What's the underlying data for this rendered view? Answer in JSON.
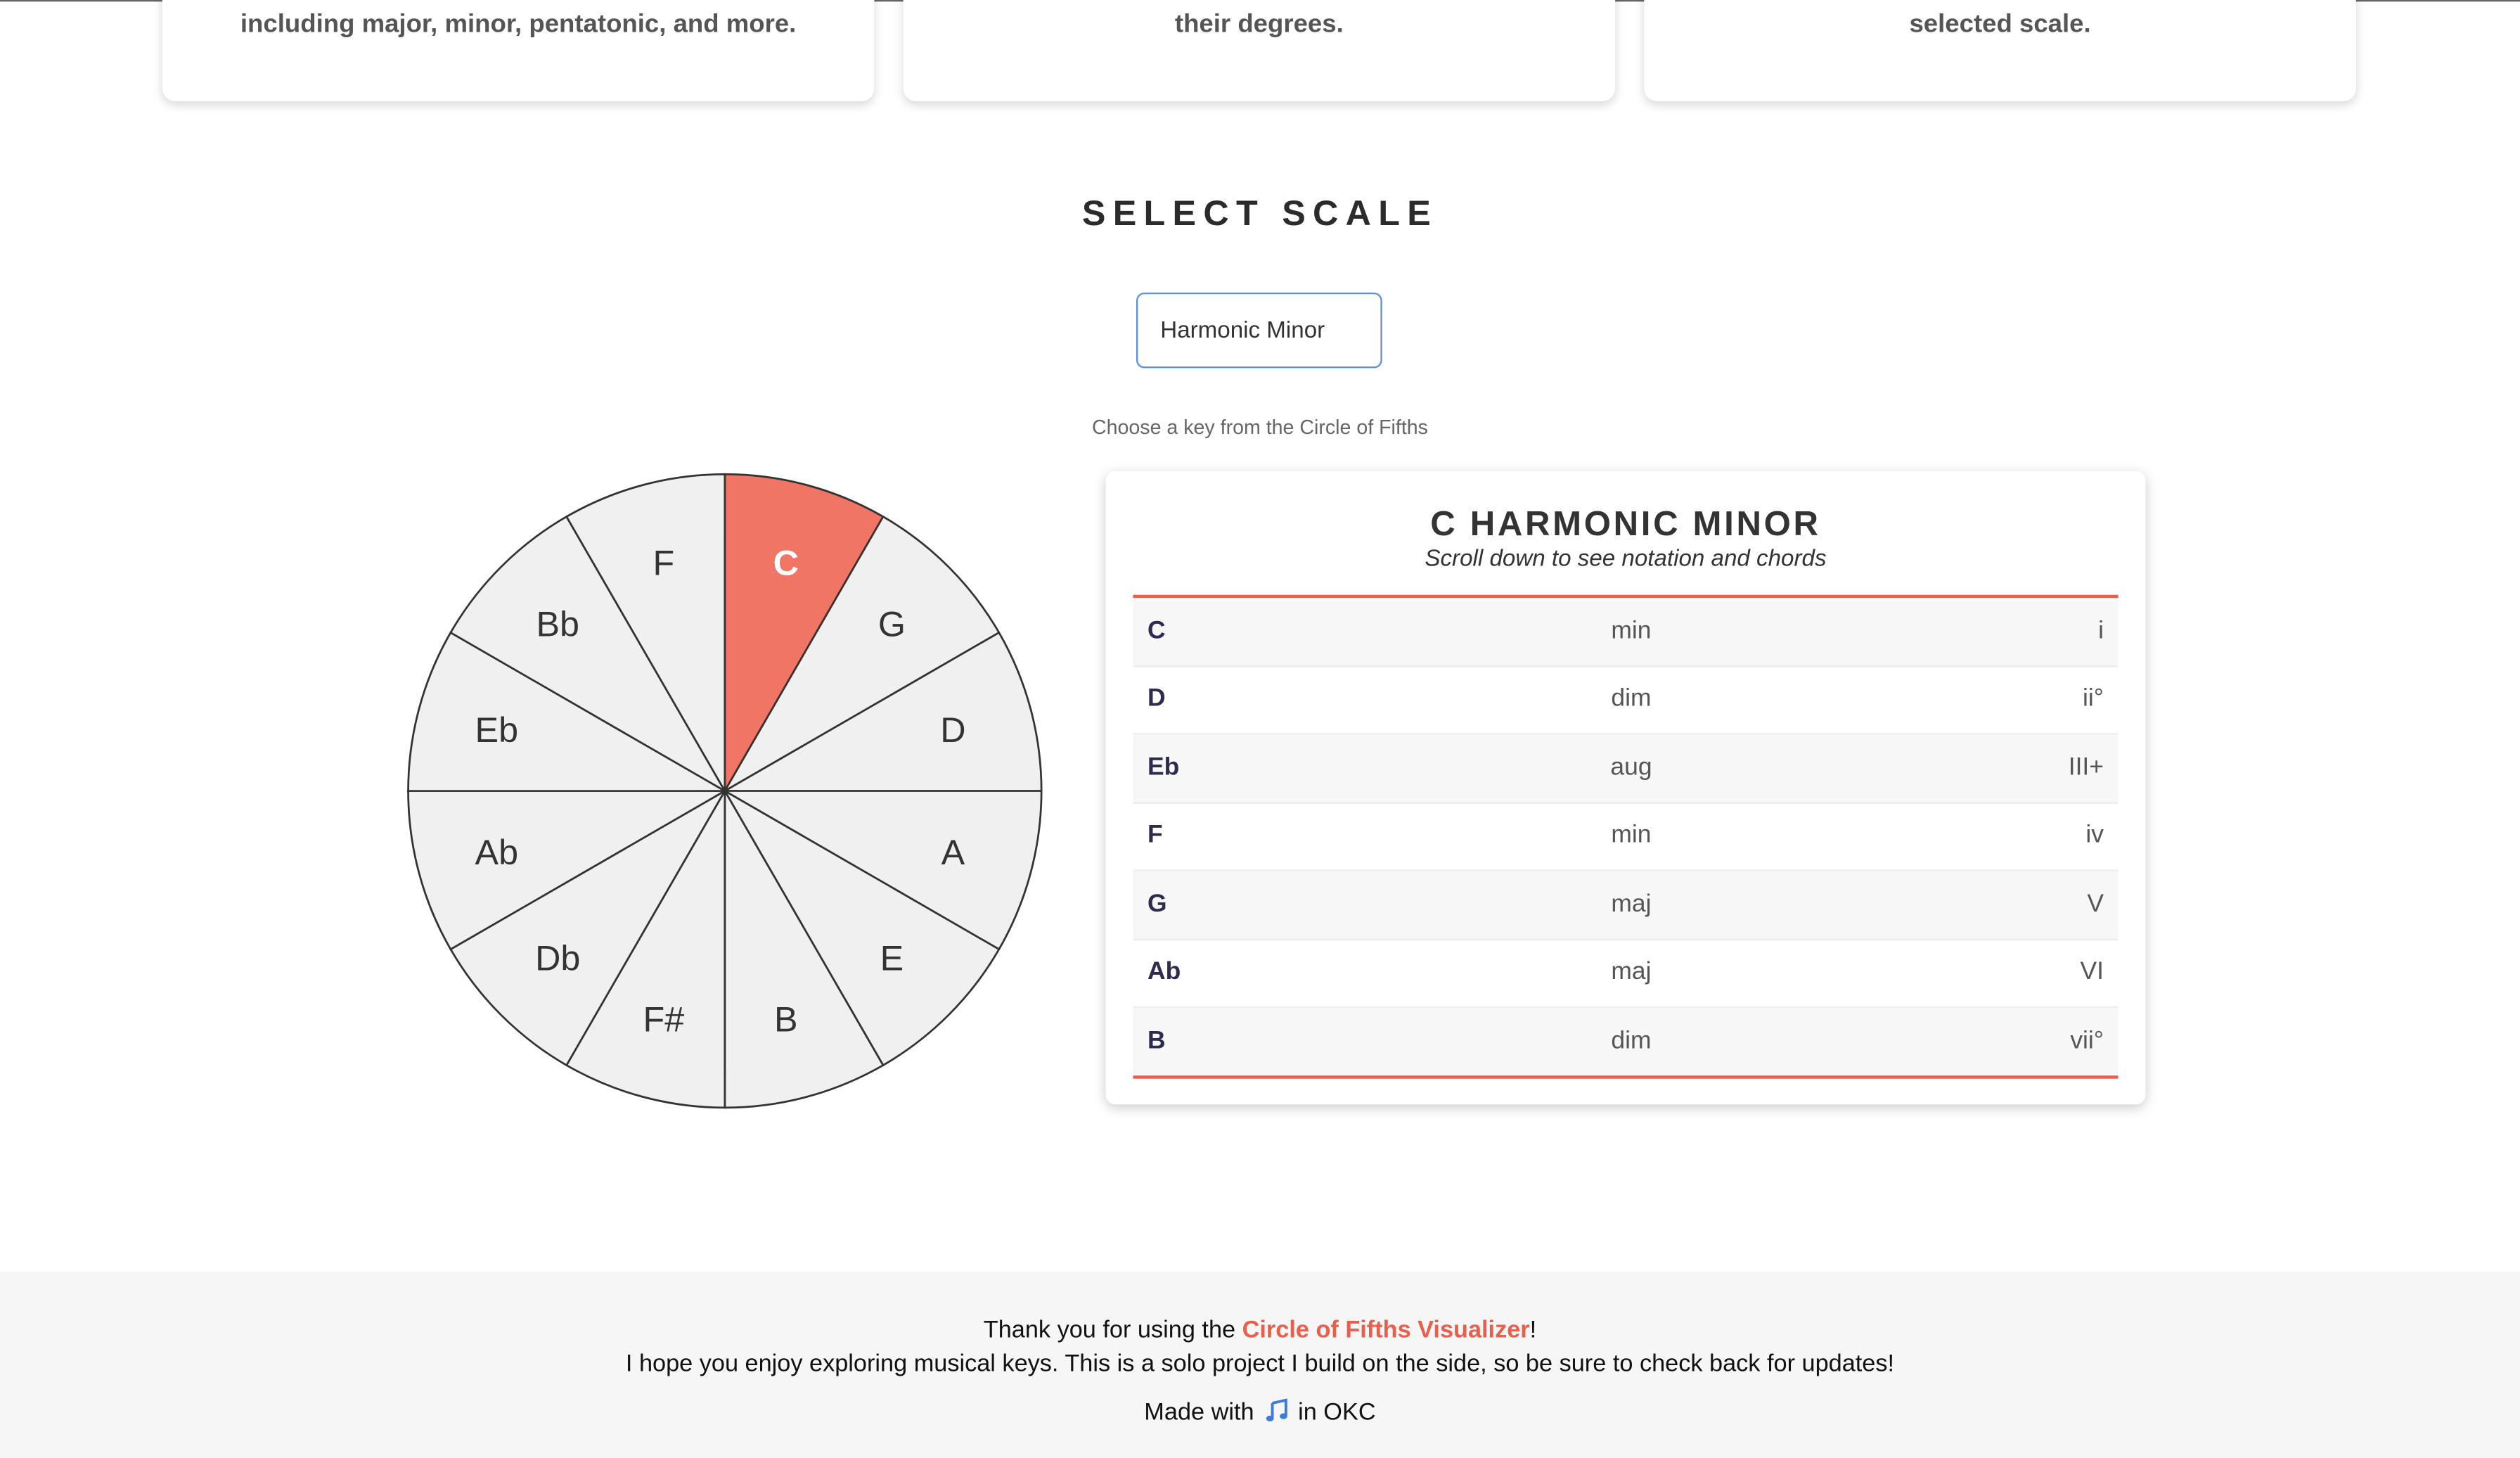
{
  "features": [
    {
      "text": "including major, minor, pentatonic, and more."
    },
    {
      "text": "their degrees."
    },
    {
      "text": "selected scale."
    }
  ],
  "section_title": "SELECT SCALE",
  "scale_select": {
    "value": "Harmonic Minor"
  },
  "hint": "Choose a key from the Circle of Fifths",
  "circle": {
    "keys": [
      "C",
      "G",
      "D",
      "A",
      "E",
      "B",
      "F#",
      "Db",
      "Ab",
      "Eb",
      "Bb",
      "F"
    ],
    "selected": "C",
    "selected_color": "#f07564",
    "fill_color": "#f0f0f0"
  },
  "panel": {
    "title": "C HARMONIC MINOR",
    "subtitle": "Scroll down to see notation and chords",
    "chords": [
      {
        "note": "C",
        "quality": "min",
        "degree": "i"
      },
      {
        "note": "D",
        "quality": "dim",
        "degree": "ii°"
      },
      {
        "note": "Eb",
        "quality": "aug",
        "degree": "III+"
      },
      {
        "note": "F",
        "quality": "min",
        "degree": "iv"
      },
      {
        "note": "G",
        "quality": "maj",
        "degree": "V"
      },
      {
        "note": "Ab",
        "quality": "maj",
        "degree": "VI"
      },
      {
        "note": "B",
        "quality": "dim",
        "degree": "vii°"
      }
    ]
  },
  "footer": {
    "thanks_prefix": "Thank you for using the ",
    "app_name": "Circle of Fifths Visualizer",
    "thanks_suffix": "!",
    "message": "I hope you enjoy exploring musical keys. This is a solo project I build on the side, so be sure to check back for updates!",
    "made_with": "Made with",
    "location": "in OKC",
    "icon": "music-note-icon"
  },
  "colors": {
    "accent": "#e8604c",
    "select_border": "#5b8fe0"
  }
}
